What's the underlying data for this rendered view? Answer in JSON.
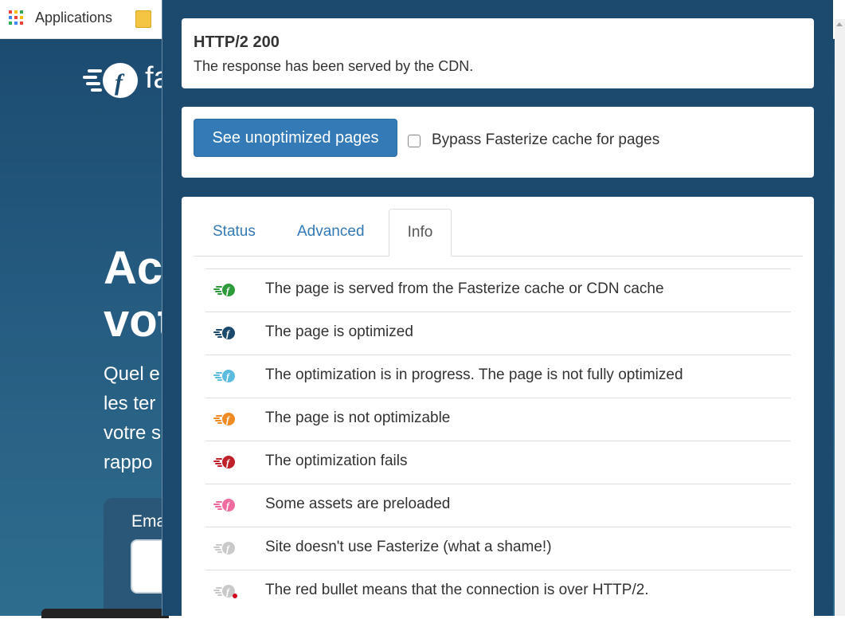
{
  "browser": {
    "bookmarks_label": "Applications",
    "apps_icon": "apps-grid-icon",
    "folder_icon": "bookmark-folder-icon"
  },
  "site": {
    "logo_text": "fa",
    "hero_title": "Ac\nvot",
    "hero_text": "Quel e\nles ter\nvotre s\nrappo",
    "form_label": "Ema"
  },
  "popup": {
    "status": {
      "code": "HTTP/2 200",
      "description": "The response has been served by the CDN."
    },
    "actions": {
      "unoptimized_button": "See unoptimized pages",
      "bypass_label": "Bypass Fasterize cache for pages",
      "bypass_checked": false
    },
    "tabs": [
      {
        "label": "Status",
        "active": false
      },
      {
        "label": "Advanced",
        "active": false
      },
      {
        "label": "Info",
        "active": true
      }
    ],
    "legend": [
      {
        "icon": "fasterize-green-icon",
        "color": "#2e9b3a",
        "dot": false,
        "text": "The page is served from the Fasterize cache or CDN cache"
      },
      {
        "icon": "fasterize-navy-icon",
        "color": "#1b4a6e",
        "dot": false,
        "text": "The page is optimized"
      },
      {
        "icon": "fasterize-lightblue-icon",
        "color": "#5bbbe0",
        "dot": false,
        "text": "The optimization is in progress. The page is not fully optimized"
      },
      {
        "icon": "fasterize-orange-icon",
        "color": "#f08a24",
        "dot": false,
        "text": "The page is not optimizable"
      },
      {
        "icon": "fasterize-red-icon",
        "color": "#c0212b",
        "dot": false,
        "text": "The optimization fails"
      },
      {
        "icon": "fasterize-pink-icon",
        "color": "#f06b9f",
        "dot": false,
        "text": "Some assets are preloaded"
      },
      {
        "icon": "fasterize-grey-icon",
        "color": "#c9c9c9",
        "dot": false,
        "text": "Site doesn't use Fasterize (what a shame!)"
      },
      {
        "icon": "fasterize-grey-reddot-icon",
        "color": "#c9c9c9",
        "dot": true,
        "text": "The red bullet means that the connection is over HTTP/2."
      }
    ]
  }
}
